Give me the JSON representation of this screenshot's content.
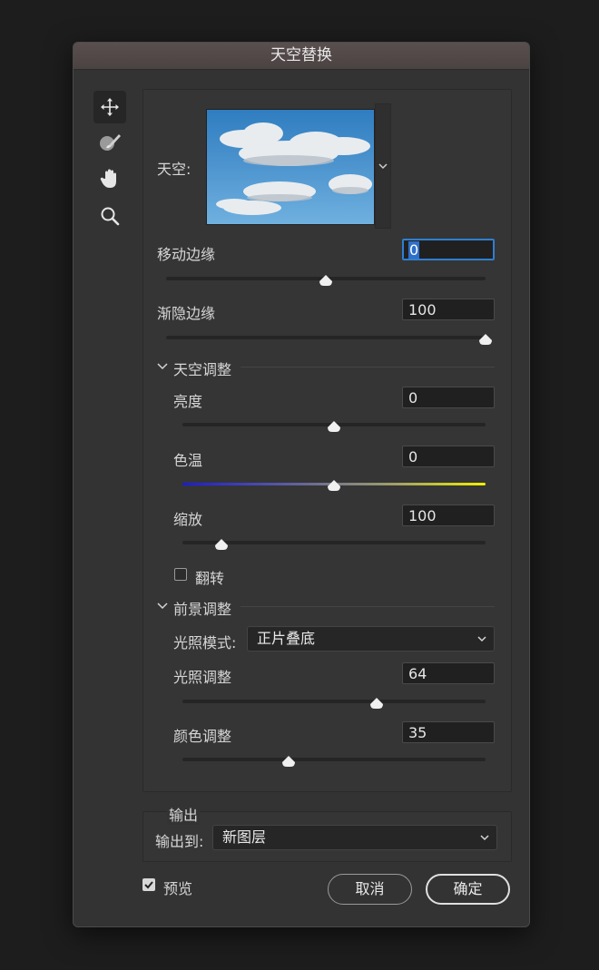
{
  "dialog": {
    "title": "天空替换"
  },
  "tools": [
    {
      "name": "move-tool",
      "active": true
    },
    {
      "name": "sky-brush-tool",
      "active": false
    },
    {
      "name": "hand-tool",
      "active": false
    },
    {
      "name": "zoom-tool",
      "active": false
    }
  ],
  "sky": {
    "label": "天空:"
  },
  "shift_edge": {
    "label": "移动边缘",
    "value": "0",
    "slider": 0.5
  },
  "fade_edge": {
    "label": "渐隐边缘",
    "value": "100",
    "slider": 1.0
  },
  "sky_adjust": {
    "header": "天空调整",
    "brightness": {
      "label": "亮度",
      "value": "0",
      "slider": 0.5
    },
    "temperature": {
      "label": "色温",
      "value": "0",
      "slider": 0.5
    },
    "scale": {
      "label": "缩放",
      "value": "100",
      "slider": 0.13
    },
    "flip": {
      "label": "翻转",
      "checked": false
    }
  },
  "foreground_adjust": {
    "header": "前景调整",
    "lighting_mode": {
      "label": "光照模式:",
      "value": "正片叠底"
    },
    "lighting_adjust": {
      "label": "光照调整",
      "value": "64",
      "slider": 0.64
    },
    "color_adjust": {
      "label": "颜色调整",
      "value": "35",
      "slider": 0.35
    }
  },
  "output": {
    "header": "输出",
    "label": "输出到:",
    "value": "新图层"
  },
  "preview": {
    "label": "预览",
    "checked": true
  },
  "buttons": {
    "cancel": "取消",
    "ok": "确定"
  },
  "colors": {
    "dialog_bg": "#333333",
    "focus_blue": "#2f7fd1",
    "temp_start": "#1b1bd8",
    "temp_end": "#f0f000"
  }
}
